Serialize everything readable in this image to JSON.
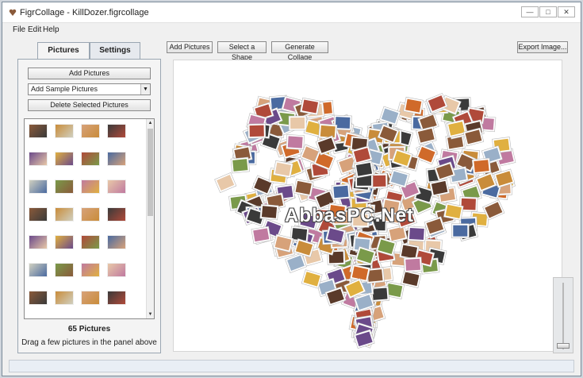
{
  "window": {
    "title": "FigrCollage - KillDozer.figrcollage",
    "controls": {
      "minimize": "—",
      "maximize": "□",
      "close": "✕"
    }
  },
  "menu": {
    "items": [
      "File",
      "Edit",
      "Help"
    ]
  },
  "tabs": [
    {
      "label": "Pictures",
      "active": true
    },
    {
      "label": "Settings",
      "active": false
    }
  ],
  "left_panel": {
    "add_pictures_label": "Add Pictures",
    "sample_select_value": "Add Sample Pictures",
    "delete_label": "Delete Selected Pictures",
    "picture_count": "65 Pictures",
    "hint": "Drag a few pictures in the panel above"
  },
  "toolbar": {
    "add_pictures_label": "Add Pictures",
    "select_shape_label": "Select a Shape",
    "generate_label": "Generate Collage",
    "export_label": "Export Image..."
  },
  "canvas": {
    "watermark": "AbbasPC.Net"
  },
  "icons": {
    "app": "app-logo-icon",
    "dropdown": "chevron-down-icon",
    "scroll_up": "scroll-up-icon",
    "scroll_down": "scroll-down-icon"
  },
  "colors": {
    "accent": "#9aa6b2",
    "canvas_bg": "#ffffff",
    "window_bg": "#f0f0f0"
  }
}
